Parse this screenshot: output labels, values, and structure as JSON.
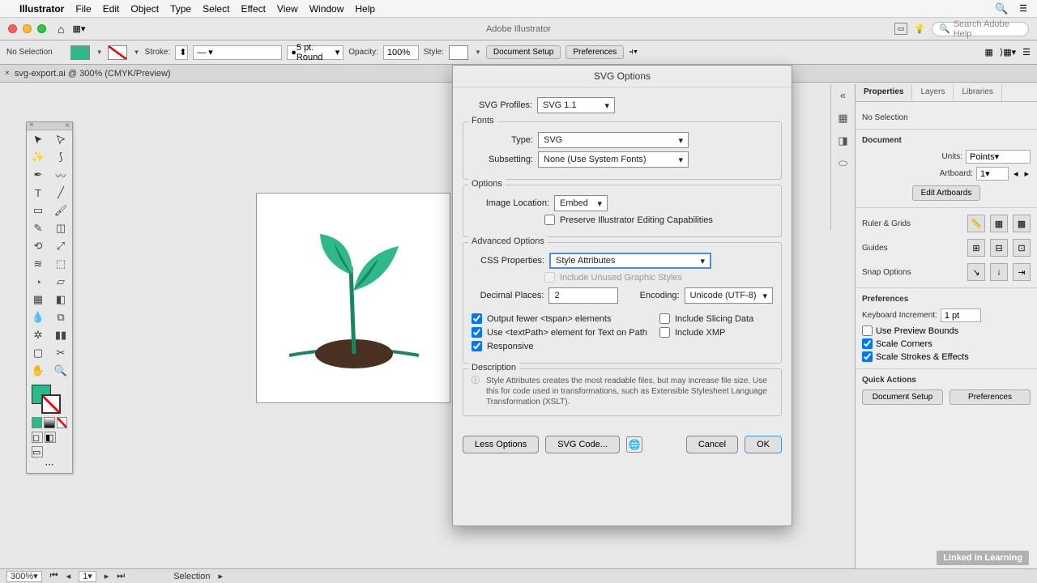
{
  "menubar": {
    "appname": "Illustrator",
    "items": [
      "File",
      "Edit",
      "Object",
      "Type",
      "Select",
      "Effect",
      "View",
      "Window",
      "Help"
    ]
  },
  "windowbar": {
    "title": "Adobe Illustrator",
    "help_placeholder": "Search Adobe Help"
  },
  "controlbar": {
    "selection": "No Selection",
    "stroke_label": "Stroke:",
    "stroke_profile": "5 pt. Round",
    "opacity_label": "Opacity:",
    "opacity_value": "100%",
    "style_label": "Style:",
    "doc_setup": "Document Setup",
    "prefs": "Preferences"
  },
  "tab": {
    "filename": "svg-export.ai @ 300% (CMYK/Preview)"
  },
  "dialog": {
    "title": "SVG Options",
    "profiles_label": "SVG Profiles:",
    "profiles_value": "SVG 1.1",
    "fonts_section": "Fonts",
    "type_label": "Type:",
    "type_value": "SVG",
    "subsetting_label": "Subsetting:",
    "subsetting_value": "None (Use System Fonts)",
    "options_section": "Options",
    "imgloc_label": "Image Location:",
    "imgloc_value": "Embed",
    "preserve_label": "Preserve Illustrator Editing Capabilities",
    "advanced_section": "Advanced Options",
    "css_label": "CSS Properties:",
    "css_value": "Style Attributes",
    "include_unused_label": "Include Unused Graphic Styles",
    "decimal_label": "Decimal Places:",
    "decimal_value": "2",
    "encoding_label": "Encoding:",
    "encoding_value": "Unicode (UTF-8)",
    "tspan_label": "Output fewer <tspan> elements",
    "slicing_label": "Include Slicing Data",
    "textpath_label": "Use <textPath> element for Text on Path",
    "xmp_label": "Include XMP",
    "responsive_label": "Responsive",
    "description_section": "Description",
    "description_text": "Style Attributes creates the most readable files, but may increase file size. Use this for code used in transformations, such as Extensible Stylesheet Language Transformation (XSLT).",
    "less_options": "Less Options",
    "svg_code": "SVG Code...",
    "cancel": "Cancel",
    "ok": "OK"
  },
  "properties": {
    "tabs": [
      "Properties",
      "Layers",
      "Libraries"
    ],
    "noselection": "No Selection",
    "document": "Document",
    "units_label": "Units:",
    "units_value": "Points",
    "artboard_label": "Artboard:",
    "artboard_value": "1",
    "edit_artboards": "Edit Artboards",
    "ruler_grids": "Ruler & Grids",
    "guides": "Guides",
    "snap_options": "Snap Options",
    "preferences": "Preferences",
    "kb_increment_label": "Keyboard Increment:",
    "kb_increment_value": "1 pt",
    "use_preview": "Use Preview Bounds",
    "scale_corners": "Scale Corners",
    "scale_strokes": "Scale Strokes & Effects",
    "quick_actions": "Quick Actions",
    "doc_setup_btn": "Document Setup",
    "prefs_btn": "Preferences"
  },
  "statusbar": {
    "zoom": "300%",
    "artboard": "1",
    "tool": "Selection"
  },
  "watermark": "Linked in Learning"
}
